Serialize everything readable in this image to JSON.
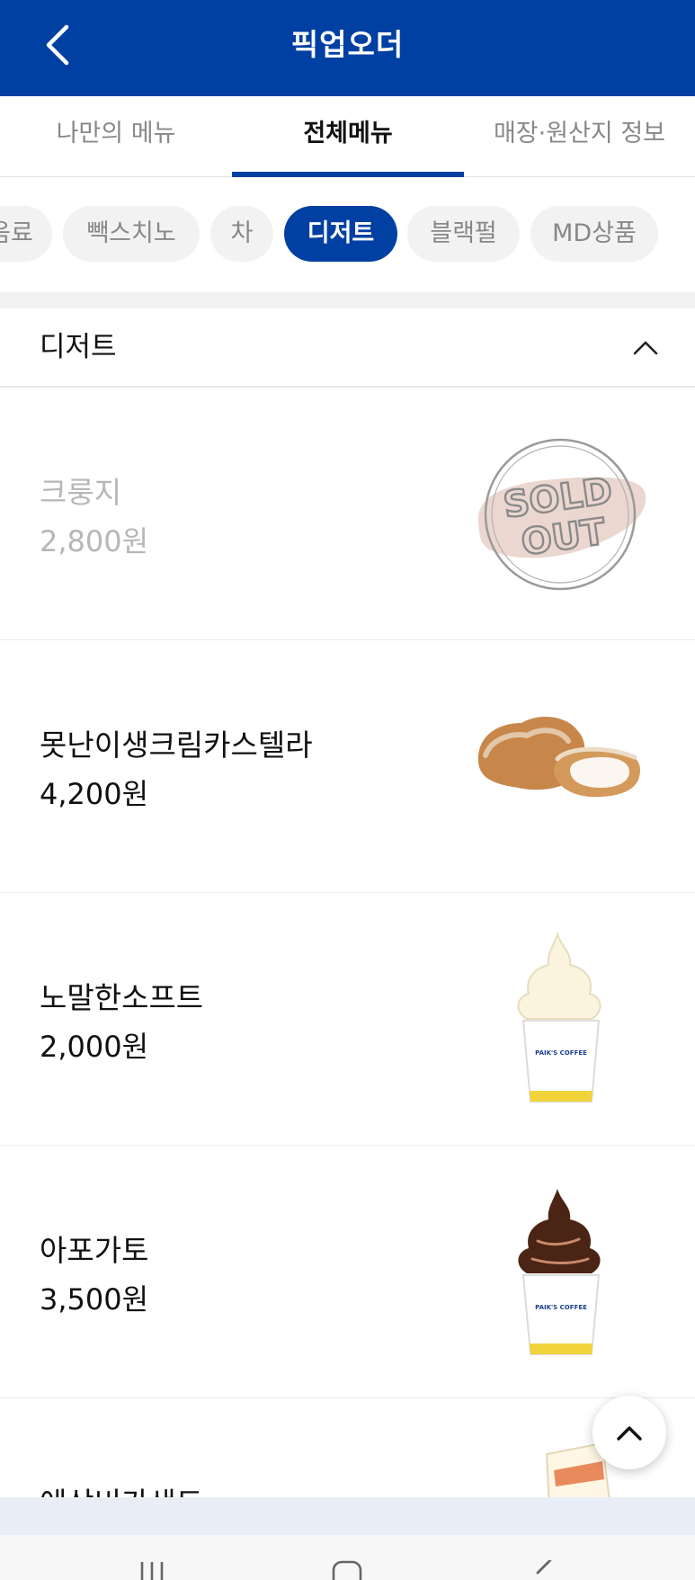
{
  "header": {
    "title": "픽업오더",
    "back_icon": "chevron-left-icon"
  },
  "tabs": [
    {
      "label": "나만의 메뉴",
      "active": false
    },
    {
      "label": "전체메뉴",
      "active": true
    },
    {
      "label": "매장·원산지 정보",
      "active": false
    }
  ],
  "categories": [
    {
      "label": "음료",
      "active": false
    },
    {
      "label": "빽스치노",
      "active": false
    },
    {
      "label": "차",
      "active": false
    },
    {
      "label": "디저트",
      "active": true
    },
    {
      "label": "블랙펄",
      "active": false
    },
    {
      "label": "MD상품",
      "active": false
    }
  ],
  "section": {
    "title": "디저트",
    "collapse_icon": "chevron-up-icon",
    "expanded": true
  },
  "menu_items": [
    {
      "name": "크룽지",
      "price": "2,800원",
      "sold_out": true,
      "badge": "SOLD OUT",
      "image": "sold-out-stamp"
    },
    {
      "name": "못난이생크림카스텔라",
      "price": "4,200원",
      "sold_out": false,
      "image": "castella-cake-image"
    },
    {
      "name": "노말한소프트",
      "price": "2,000원",
      "sold_out": false,
      "image": "vanilla-soft-serve-image"
    },
    {
      "name": "아포가토",
      "price": "3,500원",
      "sold_out": false,
      "image": "affogato-image"
    },
    {
      "name": "에삼비가샌드",
      "price": "",
      "sold_out": false,
      "image": "sandwich-image"
    }
  ],
  "cup_label": "PAIK'S COFFEE",
  "scroll_top_icon": "chevron-up-icon",
  "colors": {
    "brand": "#0040a3",
    "inactive_text": "#888888",
    "chip_bg": "#f2f2f2",
    "sold_text": "#b7b7b7"
  }
}
